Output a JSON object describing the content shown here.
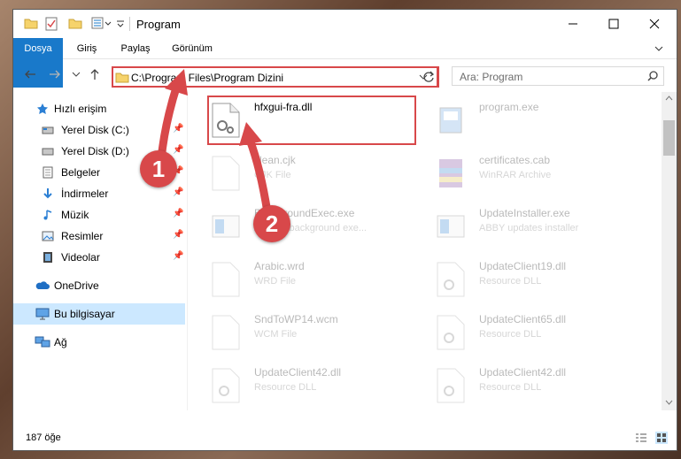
{
  "window": {
    "title": "Program"
  },
  "ribbon": {
    "tabs": [
      "Dosya",
      "Giriş",
      "Paylaş",
      "Görünüm"
    ]
  },
  "address": {
    "path": "C:\\Program Files\\Program Dizini"
  },
  "search": {
    "placeholder": "Ara: Program"
  },
  "sidebar": {
    "items": [
      {
        "label": "Hızlı erişim"
      },
      {
        "label": "Yerel Disk (C:)"
      },
      {
        "label": "Yerel Disk (D:)"
      },
      {
        "label": "Belgeler"
      },
      {
        "label": "İndirmeler"
      },
      {
        "label": "Müzik"
      },
      {
        "label": "Resimler"
      },
      {
        "label": "Videolar"
      },
      {
        "label": "OneDrive"
      },
      {
        "label": "Bu bilgisayar"
      },
      {
        "label": "Ağ"
      }
    ]
  },
  "files": [
    {
      "name": "hfxgui-fra.dll",
      "type": ""
    },
    {
      "name": "program.exe",
      "type": ""
    },
    {
      "name": "clean.cjk",
      "type": "CJK File"
    },
    {
      "name": "certificates.cab",
      "type": "WinRAR Archive"
    },
    {
      "name": "BackgroundExec.exe",
      "type": "ABBYY background exe..."
    },
    {
      "name": "UpdateInstaller.exe",
      "type": "ABBY updates installer"
    },
    {
      "name": "Arabic.wrd",
      "type": "WRD File"
    },
    {
      "name": "UpdateClient19.dll",
      "type": "Resource DLL"
    },
    {
      "name": "SndToWP14.wcm",
      "type": "WCM File"
    },
    {
      "name": "UpdateClient65.dll",
      "type": "Resource DLL"
    },
    {
      "name": "UpdateClient42.dll",
      "type": "Resource DLL"
    },
    {
      "name": "UpdateClient42.dll",
      "type": "Resource DLL"
    }
  ],
  "status": {
    "count": "187 öğe"
  },
  "markers": {
    "one": "1",
    "two": "2"
  },
  "colors": {
    "accent": "#1979ca",
    "highlight": "#d8484a",
    "selected": "#cce8ff"
  }
}
